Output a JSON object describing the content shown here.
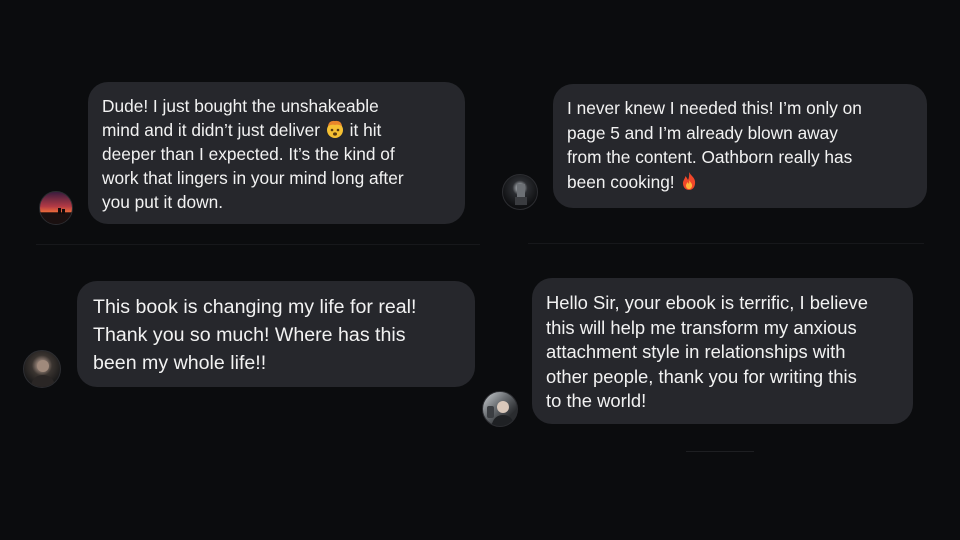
{
  "messages": [
    {
      "avatar": "sunset-avatar",
      "text_before_emoji": "Dude! I just bought the unshakeable\nmind and it didn’t just deliver ",
      "emoji": "exploding-head-emoji",
      "text_after_emoji": " it hit\ndeeper than I expected. It’s the kind of\nwork that lingers in your mind long after\nyou put it down."
    },
    {
      "avatar": "dark-figure-avatar",
      "text_before_emoji": "I never knew I needed this! I’m only on\npage 5 and I’m already blown away\nfrom the content. Oathborn really has\nbeen cooking! ",
      "emoji": "fire-emoji",
      "text_after_emoji": ""
    },
    {
      "avatar": "man-portrait-avatar",
      "text": "This book is changing my life for real!\nThank you so much! Where has this\nbeen my whole life!!"
    },
    {
      "avatar": "selfie-avatar",
      "text": "Hello Sir, your ebook is terrific, I believe\nthis will help me transform my anxious\nattachment style in relationships with\nother people,  thank you for writing this\nto the world!"
    }
  ],
  "colors": {
    "background": "#0b0c0e",
    "bubble": "#26272c",
    "text": "#f2f2f2"
  }
}
